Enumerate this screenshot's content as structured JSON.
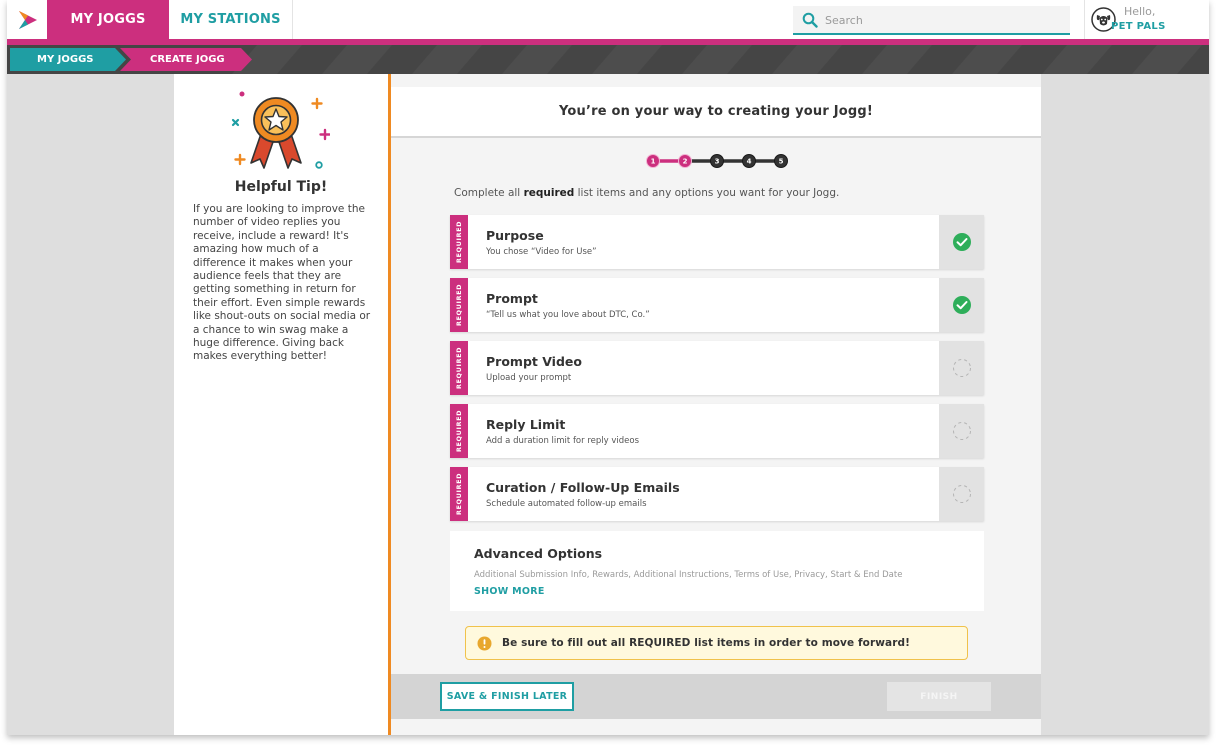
{
  "nav": {
    "tabs": [
      {
        "label": "MY JOGGS",
        "active": true
      },
      {
        "label": "MY STATIONS",
        "active": false
      }
    ]
  },
  "search": {
    "placeholder": "Search",
    "value": ""
  },
  "user": {
    "greeting": "Hello,",
    "name": "PET PALS"
  },
  "breadcrumb": [
    {
      "label": "MY JOGGS"
    },
    {
      "label": "CREATE JOGG"
    }
  ],
  "tip": {
    "title": "Helpful Tip!",
    "body": "If you are looking to improve the number of video replies you receive, include a reward! It's amazing how much of a difference it makes when your audience feels that they are getting something in return for their effort. Even simple rewards like shout-outs on social media or a chance to win swag make a huge difference. Giving back makes everything better!"
  },
  "main": {
    "heading": "You’re on your way to creating your Jogg!",
    "instructions": {
      "before": "Complete all ",
      "bold": "required",
      "after": " list items and any options you want for your Jogg."
    },
    "steps": {
      "labels": [
        "1",
        "2",
        "3",
        "4",
        "5"
      ],
      "current": 2
    },
    "required_label": "REQUIRED",
    "cards": [
      {
        "title": "Purpose",
        "description": "You chose “Video for Use”",
        "complete": true
      },
      {
        "title": "Prompt",
        "description": "“Tell us what you love about DTC, Co.”",
        "complete": true
      },
      {
        "title": "Prompt Video",
        "description": "Upload your prompt",
        "complete": false
      },
      {
        "title": "Reply Limit",
        "description": "Add a duration limit for reply videos",
        "complete": false
      },
      {
        "title": "Curation / Follow-Up Emails",
        "description": "Schedule automated follow-up emails",
        "complete": false
      }
    ],
    "advanced": {
      "title": "Advanced Options",
      "description": "Additional Submission Info, Rewards, Additional Instructions, Terms of Use, Privacy, Start & End Date",
      "show_more": "SHOW MORE"
    },
    "warning": "Be sure to fill out all REQUIRED list items in order to move forward!",
    "buttons": {
      "save": "SAVE & FINISH LATER",
      "finish": "FINISH"
    }
  },
  "colors": {
    "brand_pink": "#cc2f7e",
    "brand_teal": "#1f9ea3",
    "accent_orange": "#ef8a22",
    "success_green": "#2eae5a",
    "dark_bar": "#454545"
  },
  "icons": {
    "logo": "play-logo-icon",
    "search": "search-icon",
    "avatar": "dog-avatar-icon",
    "tip": "award-ribbon-icon",
    "complete": "check-circle-icon",
    "incomplete": "dashed-circle-icon",
    "warning": "exclamation-circle-icon"
  }
}
